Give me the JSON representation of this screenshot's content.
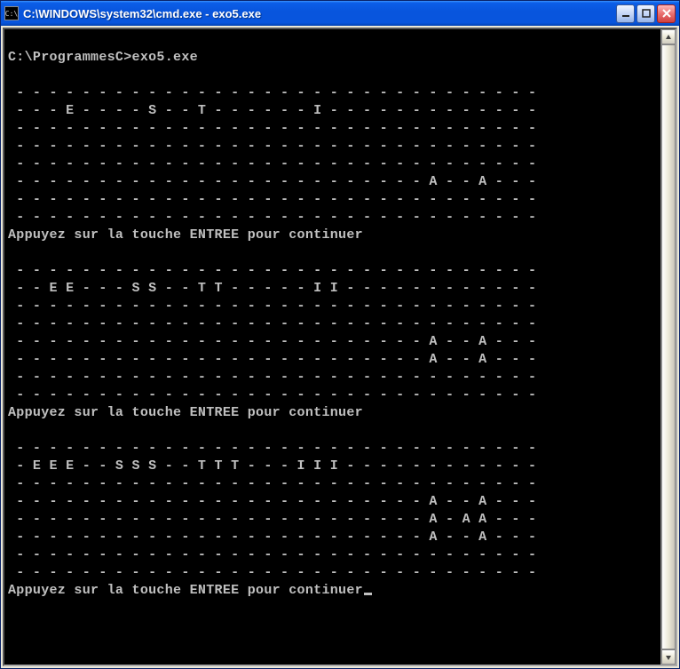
{
  "titlebar": {
    "icon_label": "C:\\",
    "text": "C:\\WINDOWS\\system32\\cmd.exe - exo5.exe"
  },
  "console": {
    "prompt_line": "C:\\ProgrammesC>exo5.exe",
    "grid1": [
      " - - - - - - - - - - - - - - - - - - - - - - - - - - - - - - - -",
      " - - - E - - - - S - - T - - - - - - I - - - - - - - - - - - - -",
      " - - - - - - - - - - - - - - - - - - - - - - - - - - - - - - - -",
      " - - - - - - - - - - - - - - - - - - - - - - - - - - - - - - - -",
      " - - - - - - - - - - - - - - - - - - - - - - - - - - - - - - - -",
      " - - - - - - - - - - - - - - - - - - - - - - - - - A - - A - - -",
      " - - - - - - - - - - - - - - - - - - - - - - - - - - - - - - - -",
      " - - - - - - - - - - - - - - - - - - - - - - - - - - - - - - - -"
    ],
    "continue_msg": "Appuyez sur la touche ENTREE pour continuer",
    "grid2": [
      " - - - - - - - - - - - - - - - - - - - - - - - - - - - - - - - -",
      " - - E E - - - S S - - T T - - - - - I I - - - - - - - - - - - -",
      " - - - - - - - - - - - - - - - - - - - - - - - - - - - - - - - -",
      " - - - - - - - - - - - - - - - - - - - - - - - - - - - - - - - -",
      " - - - - - - - - - - - - - - - - - - - - - - - - - A - - A - - -",
      " - - - - - - - - - - - - - - - - - - - - - - - - - A - - A - - -",
      " - - - - - - - - - - - - - - - - - - - - - - - - - - - - - - - -",
      " - - - - - - - - - - - - - - - - - - - - - - - - - - - - - - - -"
    ],
    "grid3": [
      " - - - - - - - - - - - - - - - - - - - - - - - - - - - - - - - -",
      " - E E E - - S S S - - T T T - - - I I I - - - - - - - - - - - -",
      " - - - - - - - - - - - - - - - - - - - - - - - - - - - - - - - -",
      " - - - - - - - - - - - - - - - - - - - - - - - - - A - - A - - -",
      " - - - - - - - - - - - - - - - - - - - - - - - - - A - A A - - -",
      " - - - - - - - - - - - - - - - - - - - - - - - - - A - - A - - -",
      " - - - - - - - - - - - - - - - - - - - - - - - - - - - - - - - -",
      " - - - - - - - - - - - - - - - - - - - - - - - - - - - - - - - -"
    ]
  }
}
